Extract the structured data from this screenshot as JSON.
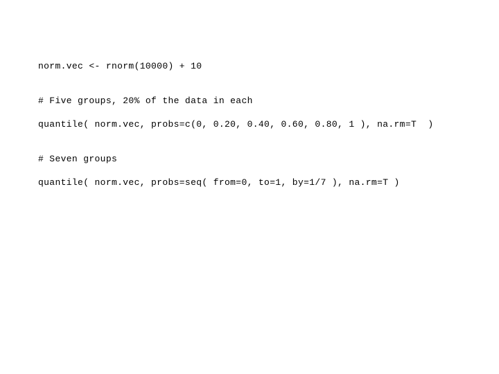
{
  "code_block": {
    "lines": [
      "norm.vec <- rnorm(10000) + 10",
      "# Five groups, 20% of the data in each",
      "quantile( norm.vec, probs=c(0, 0.20, 0.40, 0.60, 0.80, 1 ), na.rm=T  )",
      "# Seven groups",
      "quantile( norm.vec, probs=seq( from=0, to=1, by=1/7 ), na.rm=T )"
    ]
  }
}
